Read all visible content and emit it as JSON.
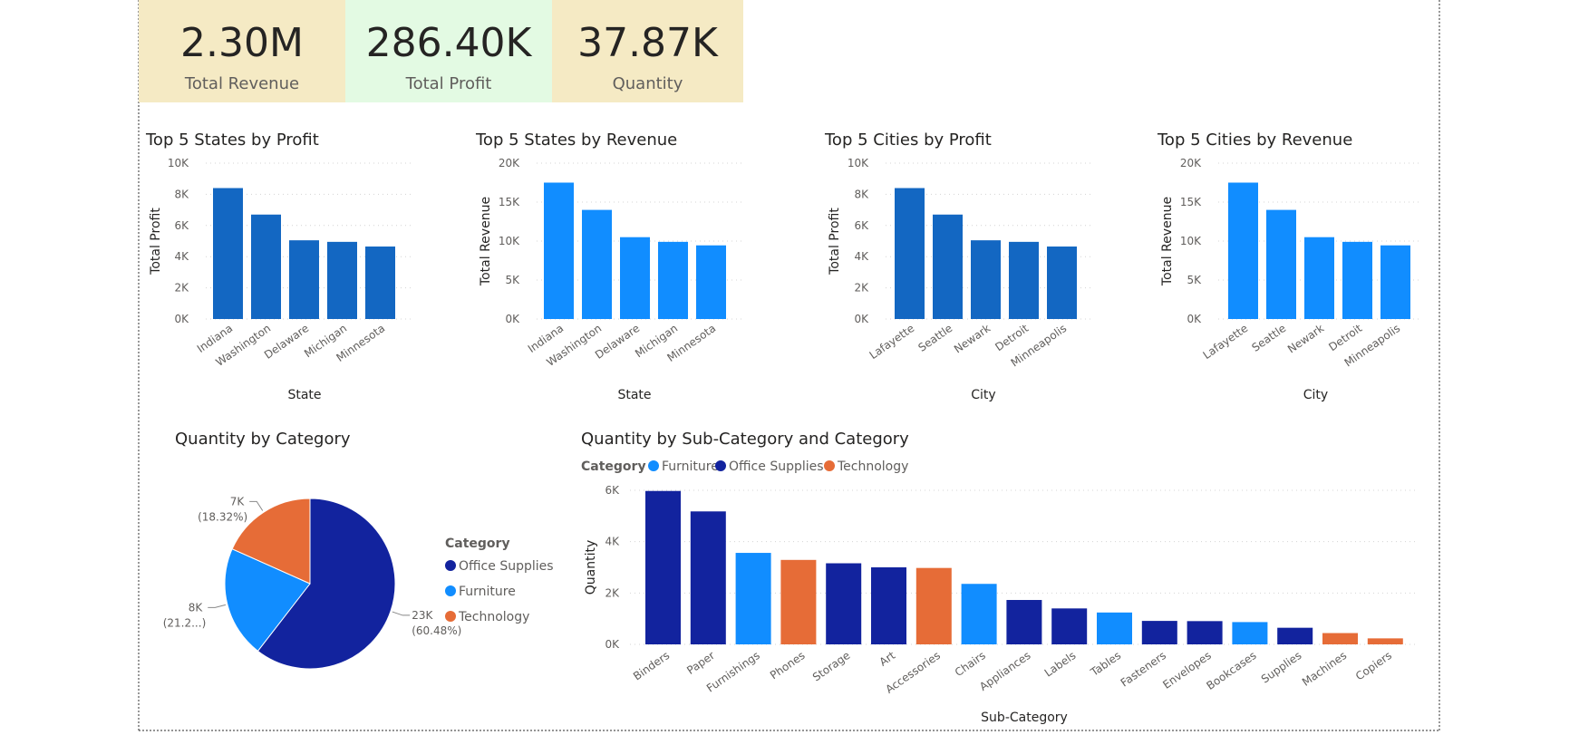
{
  "colors": {
    "dark_blue": "#1367c2",
    "light_blue": "#118dff",
    "navy": "#12239e",
    "orange": "#e66c37",
    "kpi_yellow": "#f5eac4",
    "kpi_green": "#e3fae3",
    "grid": "#d4d4d4",
    "text": "#252423",
    "subtext": "#605e5c"
  },
  "kpis": [
    {
      "value": "2.30M",
      "label": "Total Revenue"
    },
    {
      "value": "286.40K",
      "label": "Total Profit"
    },
    {
      "value": "37.87K",
      "label": "Quantity"
    }
  ],
  "chart_data": [
    {
      "id": "states-profit",
      "type": "bar",
      "title": "Top 5 States by Profit",
      "xlabel": "State",
      "ylabel": "Total Profit",
      "categories": [
        "Indiana",
        "Washington",
        "Delaware",
        "Michigan",
        "Minnesota"
      ],
      "values": [
        8400,
        6700,
        5050,
        4950,
        4650
      ],
      "ylim": [
        0,
        10000
      ],
      "ticks": [
        "0K",
        "2K",
        "4K",
        "6K",
        "8K",
        "10K"
      ],
      "color": "#1367c2"
    },
    {
      "id": "states-revenue",
      "type": "bar",
      "title": "Top 5 States by Revenue",
      "xlabel": "State",
      "ylabel": "Total Revenue",
      "categories": [
        "Indiana",
        "Washington",
        "Delaware",
        "Michigan",
        "Minnesota"
      ],
      "values": [
        17500,
        14000,
        10500,
        9900,
        9450
      ],
      "ylim": [
        0,
        20000
      ],
      "ticks": [
        "0K",
        "5K",
        "10K",
        "15K",
        "20K"
      ],
      "color": "#118dff"
    },
    {
      "id": "cities-profit",
      "type": "bar",
      "title": "Top 5 Cities by Profit",
      "xlabel": "City",
      "ylabel": "Total Profit",
      "categories": [
        "Lafayette",
        "Seattle",
        "Newark",
        "Detroit",
        "Minneapolis"
      ],
      "values": [
        8400,
        6700,
        5050,
        4950,
        4650
      ],
      "ylim": [
        0,
        10000
      ],
      "ticks": [
        "0K",
        "2K",
        "4K",
        "6K",
        "8K",
        "10K"
      ],
      "color": "#1367c2"
    },
    {
      "id": "cities-revenue",
      "type": "bar",
      "title": "Top 5 Cities by Revenue",
      "xlabel": "City",
      "ylabel": "Total Revenue",
      "categories": [
        "Lafayette",
        "Seattle",
        "Newark",
        "Detroit",
        "Minneapolis"
      ],
      "values": [
        17500,
        14000,
        10500,
        9900,
        9450
      ],
      "ylim": [
        0,
        20000
      ],
      "ticks": [
        "0K",
        "5K",
        "10K",
        "15K",
        "20K"
      ],
      "color": "#118dff"
    },
    {
      "id": "category-pie",
      "type": "pie",
      "title": "Quantity by Category",
      "legend_title": "Category",
      "legend_items": [
        "Office Supplies",
        "Furniture",
        "Technology"
      ],
      "slices": [
        {
          "name": "Office Supplies",
          "value": 22906,
          "percent": 60.48,
          "label": "23K",
          "pct_label": "(60.48%)",
          "color": "#12239e"
        },
        {
          "name": "Furniture",
          "value": 8028,
          "percent": 21.2,
          "label": "8K",
          "pct_label": "(21.2...)",
          "color": "#118dff"
        },
        {
          "name": "Technology",
          "value": 6939,
          "percent": 18.32,
          "label": "7K",
          "pct_label": "(18.32%)",
          "color": "#e66c37"
        }
      ]
    },
    {
      "id": "subcategory-bars",
      "type": "bar",
      "title": "Quantity by Sub-Category and Category",
      "xlabel": "Sub-Category",
      "ylabel": "Quantity",
      "legend_title": "Category",
      "legend_items": [
        "Furniture",
        "Office Supplies",
        "Technology"
      ],
      "ylim": [
        0,
        6000
      ],
      "ticks": [
        "0K",
        "2K",
        "4K",
        "6K"
      ],
      "categories": [
        "Binders",
        "Paper",
        "Furnishings",
        "Phones",
        "Storage",
        "Art",
        "Accessories",
        "Chairs",
        "Appliances",
        "Labels",
        "Tables",
        "Fasteners",
        "Envelopes",
        "Bookcases",
        "Supplies",
        "Machines",
        "Copiers"
      ],
      "values": [
        5974,
        5178,
        3563,
        3289,
        3158,
        3000,
        2976,
        2356,
        1729,
        1400,
        1241,
        914,
        906,
        868,
        647,
        440,
        234
      ],
      "category_of": [
        "Office Supplies",
        "Office Supplies",
        "Furniture",
        "Technology",
        "Office Supplies",
        "Office Supplies",
        "Technology",
        "Furniture",
        "Office Supplies",
        "Office Supplies",
        "Furniture",
        "Office Supplies",
        "Office Supplies",
        "Furniture",
        "Office Supplies",
        "Technology",
        "Technology"
      ]
    }
  ]
}
